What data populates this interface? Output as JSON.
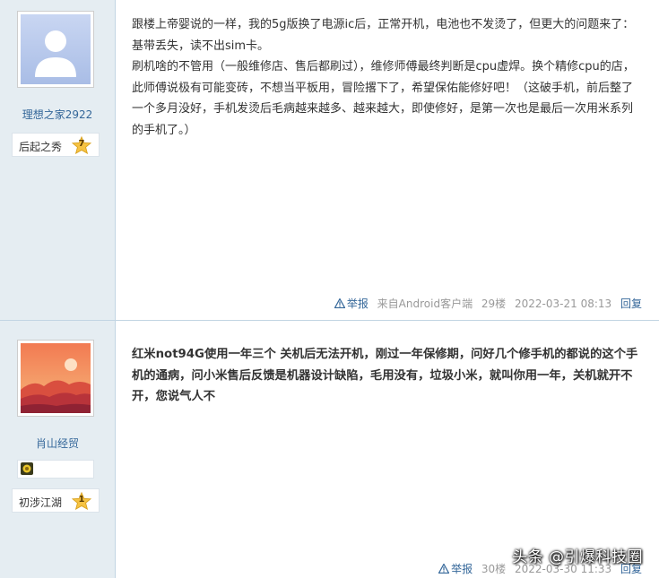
{
  "posts": [
    {
      "author": "理想之家2922",
      "rank_label": "后起之秀",
      "rank_level": "7",
      "content": [
        "跟楼上帝婴说的一样，我的5g版换了电源ic后，正常开机，电池也不发烫了，但更大的问题来了：基带丢失，读不出sim卡。",
        "刷机啥的不管用（一般维修店、售后都刷过），维修师傅最终判断是cpu虚焊。换个精修cpu的店，此师傅说极有可能变砖，不想当平板用，冒险撂下了，希望保佑能修好吧！（这破手机，前后整了一个多月没好，手机发烫后毛病越来越多、越来越大，即使修好，是第一次也是最后一次用米系列的手机了。）"
      ],
      "report_label": "举报",
      "client": "来自Android客户端",
      "floor": "29楼",
      "time": "2022-03-21 08:13",
      "reply_label": "回复"
    },
    {
      "author": "肖山经贸",
      "rank_label": "初涉江湖",
      "rank_level": "1",
      "content": [
        "红米not94G使用一年三个 关机后无法开机，刚过一年保修期，问好几个修手机的都说的这个手机的通病，问小米售后反馈是机器设计缺陷，毛用没有，垃圾小米，就叫你用一年，关机就开不开，您说气人不"
      ],
      "report_label": "举报",
      "floor": "30楼",
      "time": "2022-03-30 11:33",
      "reply_label": "回复"
    }
  ],
  "watermark": "头条 @引爆科技圈",
  "colors": {
    "sidebar_bg": "#e5edf2",
    "link": "#336699",
    "meta": "#999999",
    "star": "#f6c343"
  }
}
